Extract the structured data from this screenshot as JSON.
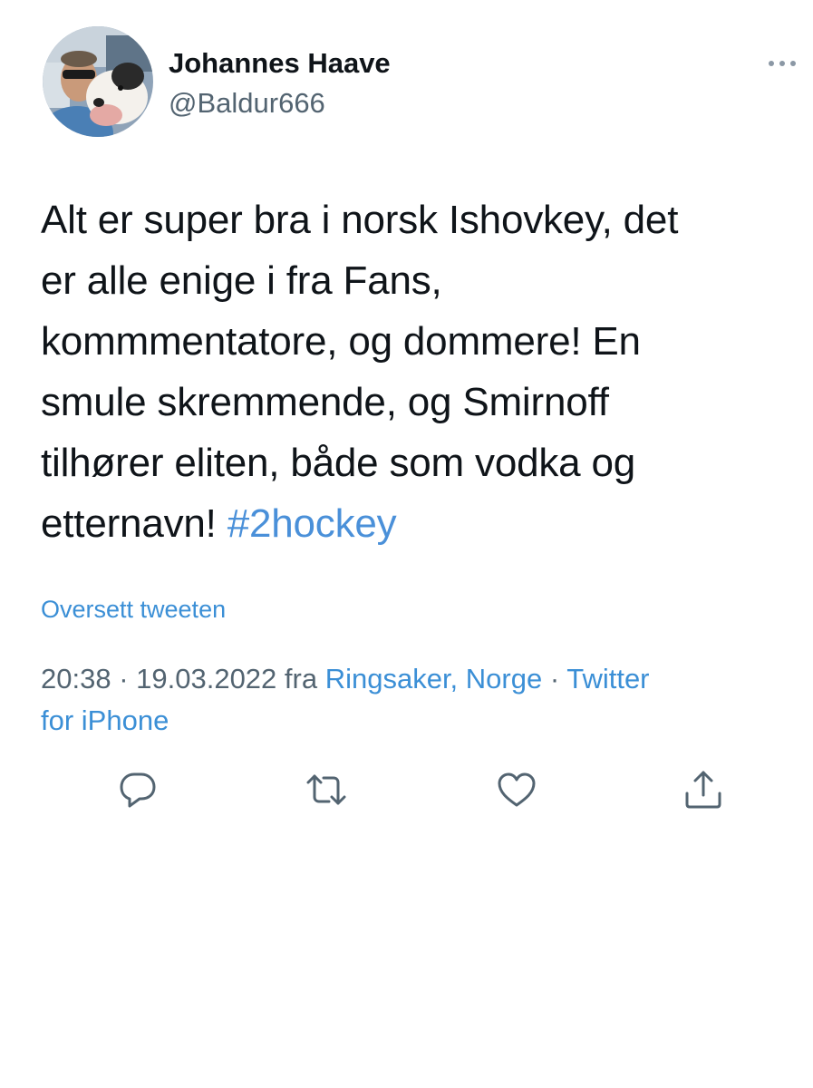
{
  "tweet": {
    "author": {
      "display_name": "Johannes Haave",
      "handle": "@Baldur666"
    },
    "text_lines": [
      "Alt er super bra i norsk Ishovkey, det",
      "er alle enige i fra Fans,",
      "kommmentatore, og dommere! En",
      "smule skremmende, og Smirnoff",
      "tilhører eliten, både som vodka og",
      "etternavn! "
    ],
    "hashtag": "#2hockey",
    "translate_label": "Oversett tweeten",
    "meta": {
      "time": "20:38",
      "separator": " · ",
      "date": "19.03.2022",
      "from_label": " fra ",
      "location": "Ringsaker, Norge",
      "separator2": " · ",
      "source_part1": "Twitter",
      "source_part2": "for iPhone"
    },
    "icons": {
      "more": "more-horizontal-icon",
      "reply": "reply-icon",
      "retweet": "retweet-icon",
      "like": "heart-icon",
      "share": "share-icon"
    },
    "colors": {
      "link": "#3b8fd6",
      "secondary_text": "#536471",
      "primary_text": "#0f1419"
    }
  }
}
